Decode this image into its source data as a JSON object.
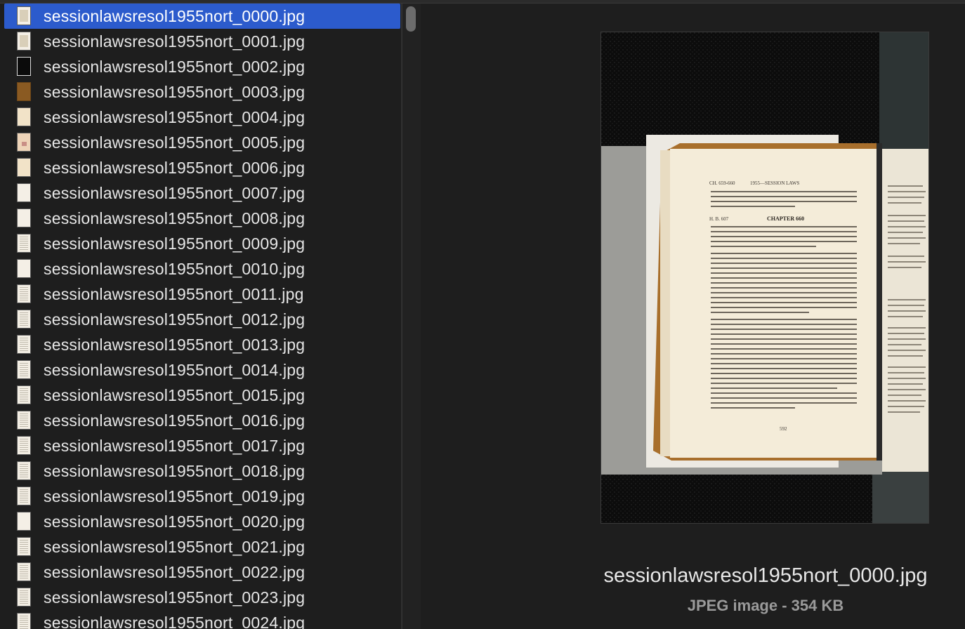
{
  "file_list": {
    "selected_index": 0,
    "files": [
      {
        "name": "sessionlawsresol1955nort_0000.jpg",
        "thumb": "t-white"
      },
      {
        "name": "sessionlawsresol1955nort_0001.jpg",
        "thumb": "t-white"
      },
      {
        "name": "sessionlawsresol1955nort_0002.jpg",
        "thumb": "t-dark"
      },
      {
        "name": "sessionlawsresol1955nort_0003.jpg",
        "thumb": "t-brown"
      },
      {
        "name": "sessionlawsresol1955nort_0004.jpg",
        "thumb": "t-cream"
      },
      {
        "name": "sessionlawsresol1955nort_0005.jpg",
        "thumb": "t-pink"
      },
      {
        "name": "sessionlawsresol1955nort_0006.jpg",
        "thumb": "t-cream"
      },
      {
        "name": "sessionlawsresol1955nort_0007.jpg",
        "thumb": "t-white"
      },
      {
        "name": "sessionlawsresol1955nort_0008.jpg",
        "thumb": "t-white"
      },
      {
        "name": "sessionlawsresol1955nort_0009.jpg",
        "thumb": "t-text"
      },
      {
        "name": "sessionlawsresol1955nort_0010.jpg",
        "thumb": "t-white"
      },
      {
        "name": "sessionlawsresol1955nort_0011.jpg",
        "thumb": "t-text"
      },
      {
        "name": "sessionlawsresol1955nort_0012.jpg",
        "thumb": "t-text"
      },
      {
        "name": "sessionlawsresol1955nort_0013.jpg",
        "thumb": "t-text"
      },
      {
        "name": "sessionlawsresol1955nort_0014.jpg",
        "thumb": "t-text"
      },
      {
        "name": "sessionlawsresol1955nort_0015.jpg",
        "thumb": "t-text"
      },
      {
        "name": "sessionlawsresol1955nort_0016.jpg",
        "thumb": "t-text"
      },
      {
        "name": "sessionlawsresol1955nort_0017.jpg",
        "thumb": "t-text"
      },
      {
        "name": "sessionlawsresol1955nort_0018.jpg",
        "thumb": "t-text"
      },
      {
        "name": "sessionlawsresol1955nort_0019.jpg",
        "thumb": "t-text"
      },
      {
        "name": "sessionlawsresol1955nort_0020.jpg",
        "thumb": "t-white"
      },
      {
        "name": "sessionlawsresol1955nort_0021.jpg",
        "thumb": "t-text"
      },
      {
        "name": "sessionlawsresol1955nort_0022.jpg",
        "thumb": "t-text"
      },
      {
        "name": "sessionlawsresol1955nort_0023.jpg",
        "thumb": "t-text"
      },
      {
        "name": "sessionlawsresol1955nort_0024.jpg",
        "thumb": "t-text"
      }
    ]
  },
  "preview": {
    "filename": "sessionlawsresol1955nort_0000.jpg",
    "meta": "JPEG image - 354 KB",
    "page": {
      "running_head_left": "CH. 659-660",
      "running_head_center": "1955—SESSION LAWS",
      "bill": "H. B. 607",
      "chapter": "CHAPTER 660",
      "page_number": "592"
    }
  },
  "colors": {
    "selection": "#2c5bcc",
    "background": "#1e1e1e",
    "text": "#e6e6e6",
    "muted": "#9a9a9a"
  }
}
